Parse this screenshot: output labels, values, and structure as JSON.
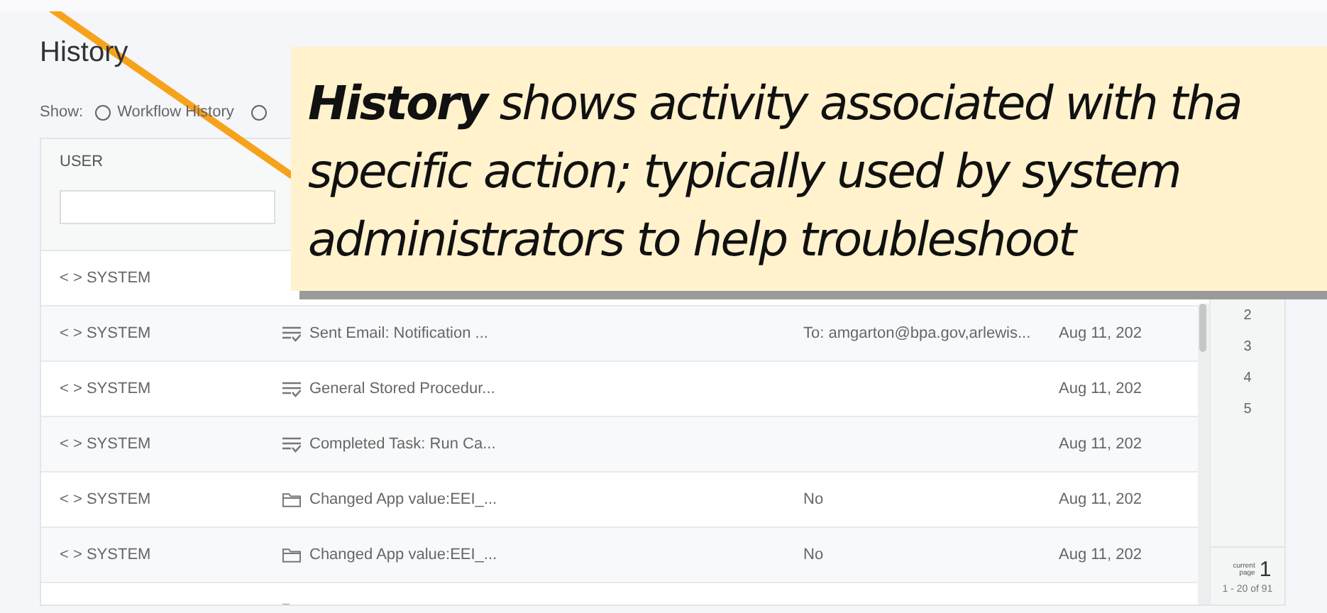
{
  "page": {
    "title": "History",
    "show_label": "Show:",
    "show_options": [
      {
        "label": "Workflow History",
        "selected": false
      },
      {
        "selected": false
      }
    ]
  },
  "table": {
    "columns": [
      {
        "label": "USER"
      }
    ],
    "rows": [
      {
        "user": "< > SYSTEM"
      },
      {
        "user": "< > SYSTEM",
        "kind": "task",
        "description": "Sent Email: Notification ...",
        "column_3": "To: amgarton@bpa.gov,arlewis...",
        "date": "Aug 11, 202"
      },
      {
        "user": "< > SYSTEM",
        "kind": "task",
        "description": "General Stored Procedur...",
        "date": "Aug 11, 202"
      },
      {
        "user": "< > SYSTEM",
        "kind": "task",
        "description": "Completed Task: Run Ca...",
        "date": "Aug 11, 202"
      },
      {
        "user": "< > SYSTEM",
        "kind": "folder",
        "description": "Changed App value:EEI_...",
        "column_3": "No",
        "date": "Aug 11, 202"
      },
      {
        "user": "< > SYSTEM",
        "kind": "folder",
        "description": "Changed App value:EEI_...",
        "column_3": "No",
        "date": "Aug 11, 202"
      },
      {
        "kind": "folder"
      }
    ]
  },
  "pagination": {
    "pages": [
      "2",
      "3",
      "4",
      "5"
    ],
    "current_label": "current page",
    "current": "1",
    "range": "1 - 20 of 91"
  },
  "callout": {
    "text": "**History** shows activity associated with tha\nspecific action; typically used by system\nadministrators to help troubleshoot"
  }
}
